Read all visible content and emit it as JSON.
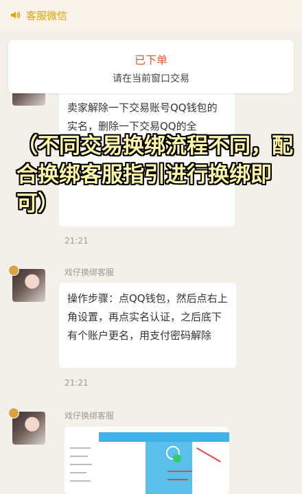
{
  "topbar": {
    "title": "客服微信",
    "icon": "speaker-icon",
    "accent": "#e6a200"
  },
  "order_card": {
    "status": "已下单",
    "hint": "请在当前窗口交易"
  },
  "messages": [
    {
      "text": "卖家解除一下交易账号QQ钱包的实名，删除一下交易QQ的全",
      "time": "21:21"
    },
    {
      "sender": "戏仔换绑客服",
      "text": "操作步骤：点QQ钱包，然后点右上角设置，再点实名认证，之后底下有个账户更名，用支付密码解除",
      "time": "21:21"
    },
    {
      "sender": "戏仔换绑客服"
    }
  ],
  "overlay": {
    "text": "（不同交易换绑流程不同，配合换绑客服指引进行换绑即可）"
  }
}
